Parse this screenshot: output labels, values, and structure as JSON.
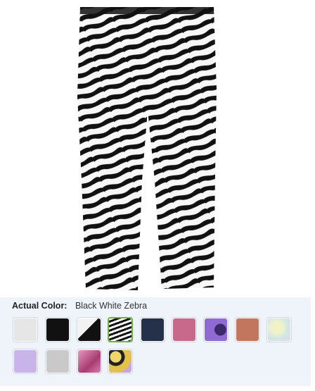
{
  "product": {
    "image_description_icon": "zebra-leggings-image"
  },
  "color_selector": {
    "label": "Actual Color:",
    "selected_value": "Black White Zebra",
    "selected_index": 3,
    "swatches": [
      {
        "name": "white-swatch",
        "color": "#e6e6e6"
      },
      {
        "name": "black-swatch",
        "color": "#111111"
      },
      {
        "name": "black-white-split-swatch",
        "color": "#1a1a1a"
      },
      {
        "name": "zebra-swatch",
        "color": "#000000"
      },
      {
        "name": "denim-swatch",
        "color": "#2a3550"
      },
      {
        "name": "pink-swatch",
        "color": "#c8698c"
      },
      {
        "name": "purple-print-swatch",
        "color": "#7a58b8"
      },
      {
        "name": "rust-swatch",
        "color": "#c2765e"
      },
      {
        "name": "tie-dye-swatch",
        "color": "#e4ecd4"
      },
      {
        "name": "lavender-swatch",
        "color": "#c8b4e8"
      },
      {
        "name": "gray-heather-swatch",
        "color": "#c9c9c9"
      },
      {
        "name": "pink-print-swatch",
        "color": "#c05a8a"
      },
      {
        "name": "yellow-camo-swatch",
        "color": "#d8c06a"
      }
    ]
  }
}
